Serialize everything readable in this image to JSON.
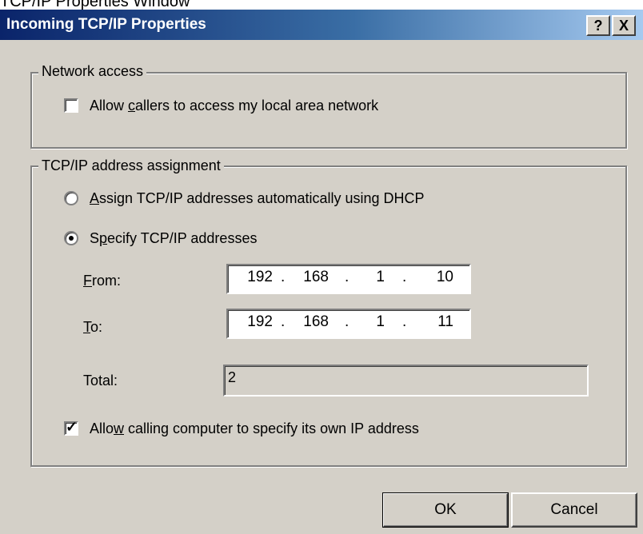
{
  "page_caption": "TCP/IP Properties Window",
  "window": {
    "title": "Incoming TCP/IP Properties",
    "help_button": "?",
    "close_button": "X"
  },
  "network_access": {
    "legend": "Network access",
    "allow_callers": {
      "label_pre": "Allow ",
      "label_ul": "c",
      "label_post": "allers to access my local area network",
      "checked": false
    }
  },
  "tcpip": {
    "legend": "TCP/IP address assignment",
    "radio_auto": {
      "label_ul": "A",
      "label_post": "ssign TCP/IP addresses automatically using DHCP",
      "selected": false
    },
    "radio_specify": {
      "label_pre": "S",
      "label_ul": "p",
      "label_post": "ecify TCP/IP addresses",
      "selected": true
    },
    "from": {
      "label_ul": "F",
      "label_post": "rom:",
      "octets": [
        "192",
        "168",
        "1",
        "10"
      ]
    },
    "to": {
      "label_ul": "T",
      "label_post": "o:",
      "octets": [
        "192",
        "168",
        "1",
        "11"
      ]
    },
    "total": {
      "label": "Total:",
      "value": "2"
    },
    "allow_own_ip": {
      "label_pre": "Allo",
      "label_ul": "w",
      "label_post": " calling computer to specify its own IP address",
      "checked": true
    }
  },
  "buttons": {
    "ok": "OK",
    "cancel": "Cancel"
  },
  "colors": {
    "face": "#d4d0c8",
    "titlebar_start": "#0a246a",
    "titlebar_end": "#a6caf0"
  }
}
